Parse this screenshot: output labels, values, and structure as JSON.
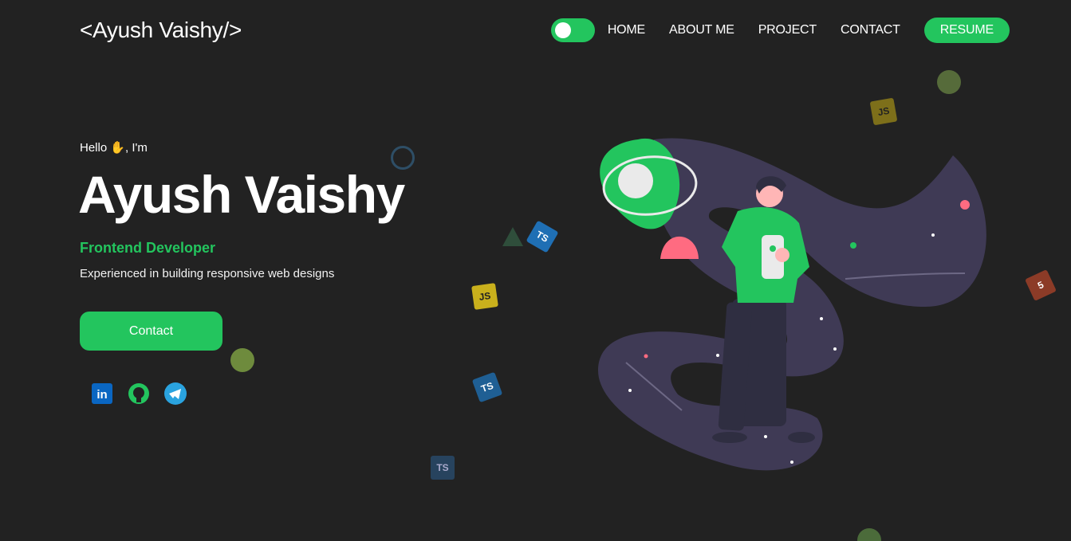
{
  "header": {
    "logo": "<Ayush Vaishy/>",
    "nav": [
      "HOME",
      "ABOUT ME",
      "PROJECT",
      "CONTACT"
    ],
    "resume_label": "RESUME",
    "theme_toggle_on": true
  },
  "hero": {
    "greeting": "Hello",
    "greeting_after": ", I'm",
    "name": "Ayush Vaishy",
    "role": "Frontend Developer",
    "tagline": "Experienced in building responsive web designs",
    "contact_label": "Contact"
  },
  "socials": [
    {
      "name": "linkedin-icon",
      "label": "in"
    },
    {
      "name": "github-icon"
    },
    {
      "name": "telegram-icon"
    }
  ],
  "tech_icons": [
    {
      "label": "JS"
    },
    {
      "label": "TS"
    },
    {
      "label": "TS"
    },
    {
      "label": "TS"
    },
    {
      "label": "JS"
    },
    {
      "label": "5"
    }
  ],
  "colors": {
    "accent": "#23c55e",
    "background": "#222222"
  }
}
